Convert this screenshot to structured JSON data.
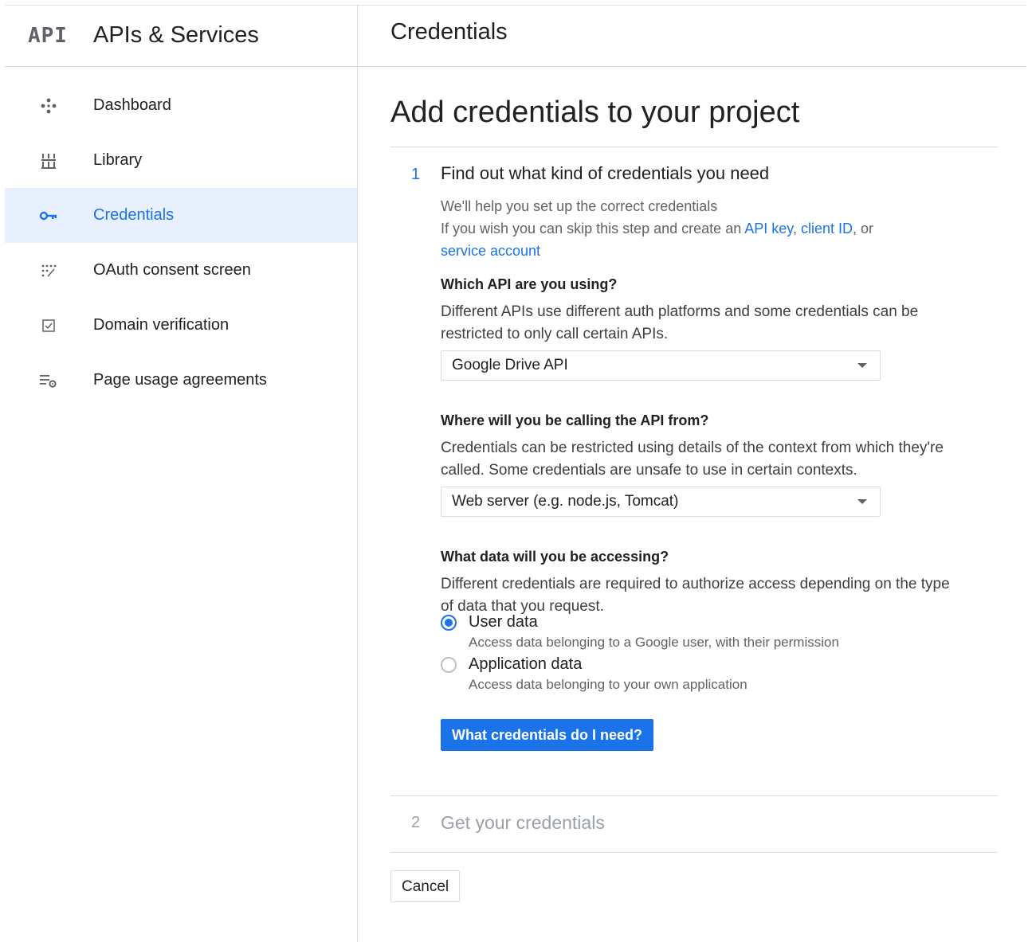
{
  "sidebar": {
    "logo_text": "API",
    "title": "APIs & Services",
    "items": [
      {
        "label": "Dashboard",
        "icon": "dashboard-icon",
        "active": false
      },
      {
        "label": "Library",
        "icon": "library-icon",
        "active": false
      },
      {
        "label": "Credentials",
        "icon": "key-icon",
        "active": true
      },
      {
        "label": "OAuth consent screen",
        "icon": "consent-icon",
        "active": false
      },
      {
        "label": "Domain verification",
        "icon": "checkbox-icon",
        "active": false
      },
      {
        "label": "Page usage agreements",
        "icon": "settings-list-icon",
        "active": false
      }
    ]
  },
  "header": {
    "title": "Credentials"
  },
  "main": {
    "heading": "Add credentials to your project",
    "step1": {
      "number": "1",
      "title": "Find out what kind of credentials you need",
      "intro_line1": "We'll help you set up the correct credentials",
      "intro_line2_prefix": "If you wish you can skip this step and create an",
      "link_api_key": "API key",
      "link_client_id": "client ID",
      "intro_or": ", or",
      "link_service_account": "service account",
      "q1": "Which API are you using?",
      "q1_desc": "Different APIs use different auth platforms and some credentials can be restricted to only call certain APIs.",
      "q1_value": "Google Drive API",
      "q2": "Where will you be calling the API from?",
      "q2_desc": "Credentials can be restricted using details of the context from which they're called. Some credentials are unsafe to use in certain contexts.",
      "q2_value": "Web server (e.g. node.js, Tomcat)",
      "q3": "What data will you be accessing?",
      "q3_desc": "Different credentials are required to authorize access depending on the type of data that you request.",
      "options": [
        {
          "label": "User data",
          "sub": "Access data belonging to a Google user, with their permission",
          "checked": true
        },
        {
          "label": "Application data",
          "sub": "Access data belonging to your own application",
          "checked": false
        }
      ],
      "button": "What credentials do I need?"
    },
    "step2": {
      "number": "2",
      "title": "Get your credentials"
    },
    "cancel": "Cancel"
  },
  "colors": {
    "accent": "#1a73e8",
    "active_bg": "#e8f0fe",
    "divider": "#dadce0"
  }
}
